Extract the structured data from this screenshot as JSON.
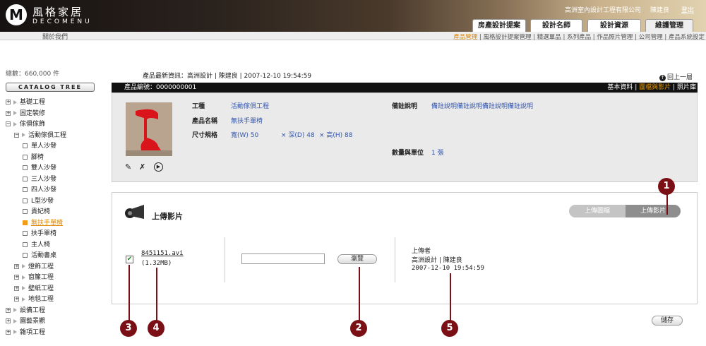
{
  "header": {
    "logo_mark": "M",
    "brand": "風格家居",
    "brand_en": "DECOMENU",
    "company": "高洲室內設計工程有限公司",
    "user": "陳建良",
    "logout": "登出",
    "tabs": [
      "房產設計提案",
      "設計名師",
      "設計資源",
      "維護管理"
    ],
    "about": "關於我們"
  },
  "subnav": {
    "items": [
      "產品管理",
      "風格設計提案管理",
      "精選單品",
      "系列產品",
      "作品照片管理",
      "公司管理",
      "產品系統設定"
    ]
  },
  "sidebar": {
    "total": "總數：660,000 件",
    "catalog_button": "CATALOG TREE",
    "tree": [
      {
        "label": "基礎工程",
        "kind": "plus",
        "level": 0
      },
      {
        "label": "固定裝修",
        "kind": "plus",
        "level": 0
      },
      {
        "label": "傢俱傢飾",
        "kind": "minus",
        "level": 0
      },
      {
        "label": "活動傢俱工程",
        "kind": "minus",
        "level": 1
      },
      {
        "label": "單人沙發",
        "kind": "sq",
        "level": 2
      },
      {
        "label": "腳椅",
        "kind": "sq",
        "level": 2
      },
      {
        "label": "雙人沙發",
        "kind": "sq",
        "level": 2
      },
      {
        "label": "三人沙發",
        "kind": "sq",
        "level": 2
      },
      {
        "label": "四人沙發",
        "kind": "sq",
        "level": 2
      },
      {
        "label": "L型沙發",
        "kind": "sq",
        "level": 2
      },
      {
        "label": "貴妃椅",
        "kind": "sq",
        "level": 2
      },
      {
        "label": "無扶手單椅",
        "kind": "sel",
        "level": 2
      },
      {
        "label": "扶手單椅",
        "kind": "sq",
        "level": 2
      },
      {
        "label": "主人椅",
        "kind": "sq",
        "level": 2
      },
      {
        "label": "活動書桌",
        "kind": "sq",
        "level": 2
      },
      {
        "label": "燈飾工程",
        "kind": "plus",
        "level": 1
      },
      {
        "label": "窗簾工程",
        "kind": "plus",
        "level": 1
      },
      {
        "label": "壁紙工程",
        "kind": "plus",
        "level": 1
      },
      {
        "label": "地毯工程",
        "kind": "plus",
        "level": 1
      },
      {
        "label": "設備工程",
        "kind": "plus",
        "level": 0
      },
      {
        "label": "園藝景觀",
        "kind": "plus",
        "level": 0
      },
      {
        "label": "雜項工程",
        "kind": "plus",
        "level": 0
      }
    ]
  },
  "main": {
    "news": "產品最新資訊：高洲設計 | 陳建良 | 2007-12-10  19:54:59",
    "back": "回上一層",
    "product": {
      "code": "產品編號：0000000001",
      "links": [
        "基本資料",
        "圖檔與影片",
        "照片庫"
      ],
      "type_label": "工種",
      "type_value": "活動傢俱工程",
      "name_label": "產品名稱",
      "name_value": "無扶手單椅",
      "size_label": "尺寸規格",
      "size_w": "寬(W)  50",
      "size_d": "× 深(D) 48",
      "size_h": "× 高(H) 88",
      "note_label": "備註說明",
      "note_value": "備註說明備註說明備註說明備註說明",
      "qty_label": "數量與單位",
      "qty_value": "1 張"
    },
    "upload": {
      "title": "上傳影片",
      "seg_image": "上傳圖檔",
      "seg_video": "上傳影片",
      "file_name": "8451151.avi",
      "file_size": "(1.32MB)",
      "browse": "瀏覽",
      "uploader_label": "上傳者",
      "uploader": "高洲設計 | 陳建良",
      "uploaded_at": "2007-12-10  19:54:59",
      "save": "儲存"
    }
  },
  "markers": [
    "1",
    "2",
    "3",
    "4",
    "5"
  ],
  "colors": {
    "marker": "#7a1015",
    "active": "#e08800"
  }
}
